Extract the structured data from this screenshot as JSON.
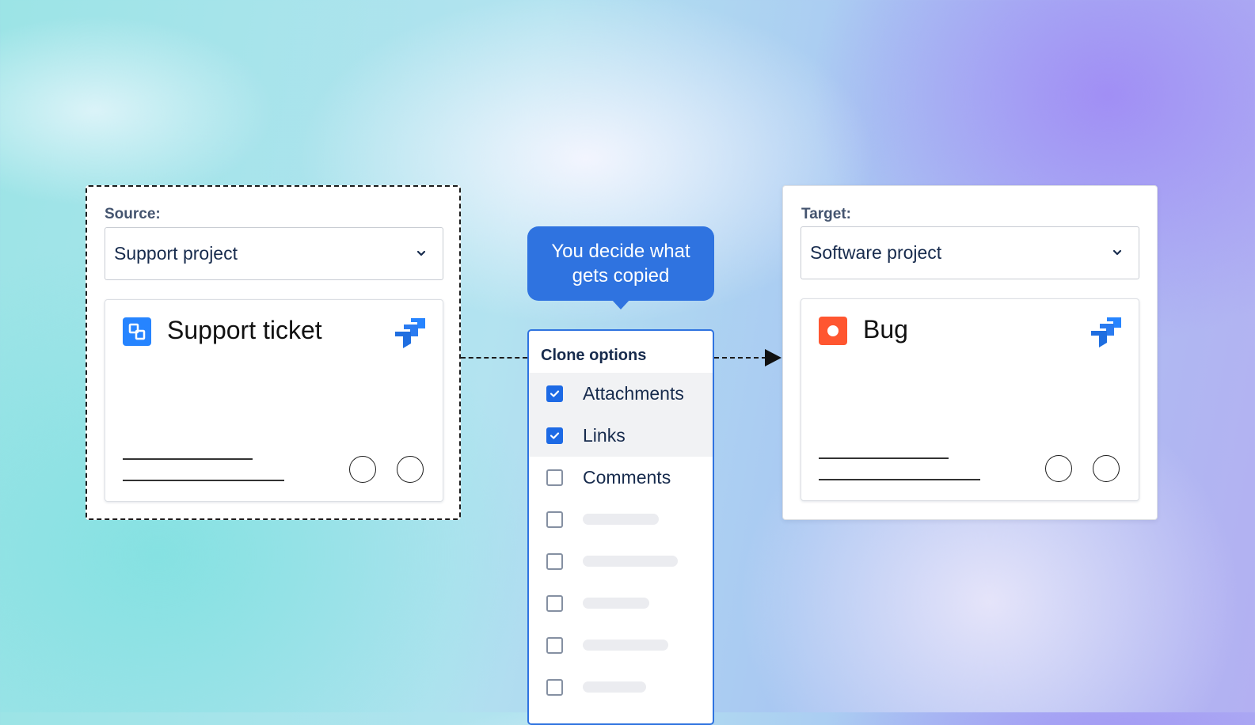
{
  "source": {
    "label": "Source:",
    "select_value": "Support project",
    "card": {
      "title": "Support ticket",
      "icon": "support-ticket-icon",
      "logo": "jira-logo-icon"
    }
  },
  "callout": {
    "text": "You decide what gets copied"
  },
  "clone_options": {
    "title": "Clone options",
    "items": [
      {
        "label": "Attachments",
        "checked": true
      },
      {
        "label": "Links",
        "checked": true
      },
      {
        "label": "Comments",
        "checked": false
      }
    ],
    "placeholder_count": 5
  },
  "target": {
    "label": "Target:",
    "select_value": "Software project",
    "card": {
      "title": "Bug",
      "icon": "bug-icon",
      "logo": "jira-logo-icon"
    }
  },
  "colors": {
    "accent": "#2f73e0",
    "checkbox_checked": "#1d6ae5",
    "ticket_icon": "#2684ff",
    "bug_icon": "#ff5630",
    "jira_logo": "#2684ff"
  }
}
